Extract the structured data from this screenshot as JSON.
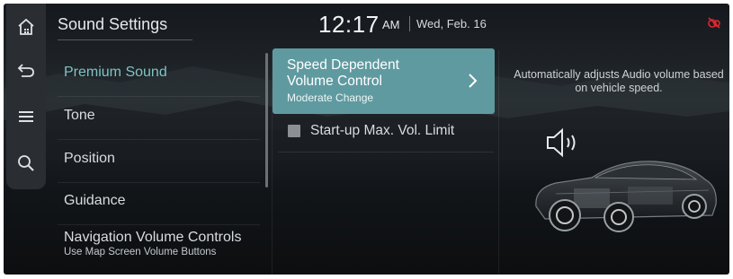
{
  "header": {
    "title": "Sound Settings",
    "time": "12:17",
    "ampm": "AM",
    "date": "Wed, Feb. 16"
  },
  "rail": [
    {
      "icon": "home-icon"
    },
    {
      "icon": "back-icon"
    },
    {
      "icon": "menu-icon"
    },
    {
      "icon": "search-icon"
    }
  ],
  "status": {
    "icon": "connectivity-off-icon",
    "color": "#e0282f"
  },
  "menu": {
    "items": [
      {
        "label": "Premium Sound",
        "active": true
      },
      {
        "label": "Tone"
      },
      {
        "label": "Position"
      },
      {
        "label": "Guidance"
      },
      {
        "label": "Navigation Volume Controls",
        "sub": "Use Map Screen Volume Buttons"
      }
    ]
  },
  "options": {
    "speed_dependent": {
      "title": "Speed Dependent Volume Control",
      "value": "Moderate Change"
    },
    "startup_limit": {
      "label": "Start-up Max. Vol. Limit",
      "checked": false
    }
  },
  "description": "Automatically adjusts Audio volume based on vehicle speed.",
  "colors": {
    "accent": "#5f9aa0",
    "active_text": "#7fc3c1"
  }
}
